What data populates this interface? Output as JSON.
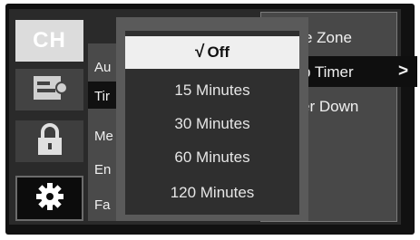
{
  "icons": {
    "channel_label": "CH",
    "items": [
      "channel-icon",
      "picture-icon",
      "lock-icon",
      "gear-icon"
    ]
  },
  "middle_menu": {
    "items": [
      "Au",
      "Tir",
      "Me",
      "En",
      "Fa"
    ]
  },
  "right_panel": {
    "items": [
      "e Zone",
      "p Timer",
      "er Down"
    ],
    "arrow": ">"
  },
  "popup": {
    "check": "√",
    "options": [
      "Off",
      "15 Minutes",
      "30 Minutes",
      "60 Minutes",
      "120 Minutes"
    ],
    "selected_index": 0
  }
}
